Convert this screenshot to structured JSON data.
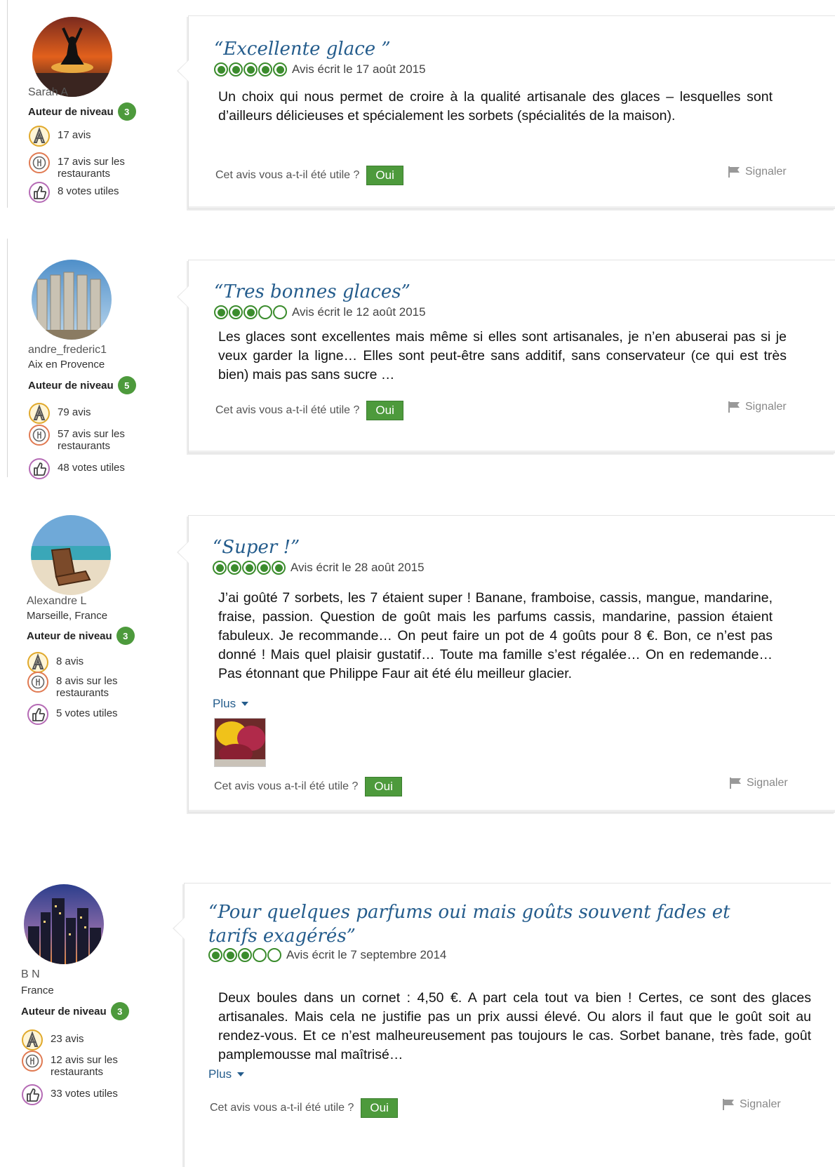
{
  "helpful_question": "Cet avis vous a-t-il été utile ?",
  "yes_label": "Oui",
  "report_label": "Signaler",
  "more_label": "Plus",
  "level_label": "Auteur de niveau",
  "colors": {
    "brand_green": "#4d9a3c",
    "bubble_green": "#3b8c2d",
    "title_blue": "#245c8c"
  },
  "reviews": [
    {
      "member": {
        "name": "Sarah A",
        "location": "",
        "level": "3",
        "avatar_icon": "yoga-sunset-avatar",
        "stats": [
          "17 avis",
          "17 avis sur les restaurants",
          "8 votes utiles"
        ]
      },
      "title": "“Excellente glace ”",
      "rating": 5,
      "date": "Avis écrit le 17 août 2015",
      "body": "Un choix qui nous permet de croire à la qualité artisanale des glaces – lesquelles sont d’ailleurs délicieuses et spécialement les sorbets (spécialités de la maison).",
      "has_more": false,
      "has_photo": false
    },
    {
      "member": {
        "name": "andre_frederic1",
        "location": "Aix en Provence",
        "level": "5",
        "avatar_icon": "columns-avatar",
        "stats": [
          "79 avis",
          "57 avis sur les restaurants",
          "48 votes utiles"
        ]
      },
      "title": "“Tres bonnes glaces”",
      "rating": 3,
      "date": "Avis écrit le 12 août 2015",
      "body": "Les glaces sont excellentes mais même si elles sont artisanales, je n’en abuserai pas si je veux garder la ligne… Elles sont peut-être sans additif, sans conservateur (ce qui est très bien) mais pas sans sucre …",
      "has_more": false,
      "has_photo": false
    },
    {
      "member": {
        "name": "Alexandre L",
        "location": "Marseille, France",
        "level": "3",
        "avatar_icon": "beach-chair-avatar",
        "stats": [
          "8 avis",
          "8 avis sur les restaurants",
          "5 votes utiles"
        ]
      },
      "title": "“Super !”",
      "rating": 5,
      "date": "Avis écrit le 28 août 2015",
      "body": "J’ai goûté 7 sorbets, les 7 étaient super ! Banane, framboise, cassis, mangue, mandarine, fraise, passion. Question de goût mais les parfums cassis, mandarine, passion étaient fabuleux. Je recommande… On peut faire un pot de 4 goûts pour 8 €. Bon, ce n’est pas donné ! Mais quel plaisir gustatif… Toute ma famille s’est régalée… On en redemande… Pas étonnant que Philippe Faur ait été élu meilleur glacier.",
      "has_more": true,
      "has_photo": true
    },
    {
      "member": {
        "name": "B N",
        "location": "France",
        "level": "3",
        "avatar_icon": "city-night-avatar",
        "stats": [
          "23 avis",
          "12 avis sur les restaurants",
          "33 votes utiles"
        ]
      },
      "title": "“Pour quelques parfums oui mais goûts souvent fades et tarifs exagérés”",
      "rating": 3,
      "date": "Avis écrit le 7 septembre 2014",
      "body": "Deux boules dans un cornet : 4,50 €. A part cela tout va bien ! Certes, ce sont des glaces artisanales. Mais cela ne justifie pas un prix aussi élevé. Ou alors il faut que le goût soit au rendez-vous. Et ce n’est malheureusement pas toujours le cas. Sorbet banane, très fade, goût pamplemousse mal maîtrisé…",
      "has_more": true,
      "has_photo": false
    }
  ]
}
